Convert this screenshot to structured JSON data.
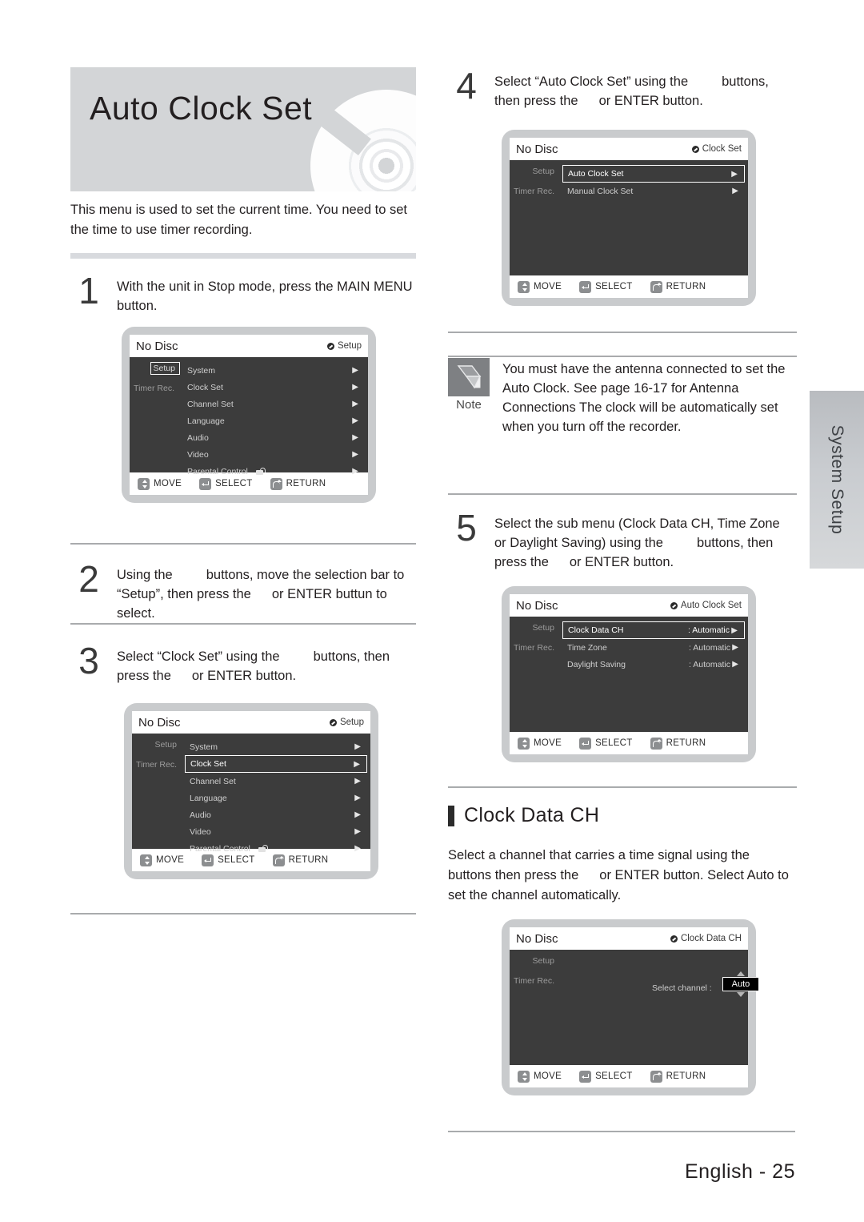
{
  "page": {
    "footer_text": "English - 25",
    "side_tab_label": "System Setup"
  },
  "hero": {
    "title": "Auto Clock Set"
  },
  "intro": {
    "text": "This menu is used to set the current time. You need to set the time to use timer recording."
  },
  "steps": [
    {
      "number": "1",
      "text_before": "With the unit in Stop mode, press the MAIN MENU button.",
      "text_mid": "",
      "text_after": ""
    },
    {
      "number": "2",
      "text_before": "Using the",
      "text_mid": "buttons, move the selection bar to “Setup”, then press the",
      "text_after": "or ENTER buttun to select."
    },
    {
      "number": "3",
      "text_before": "Select “Clock Set” using the",
      "text_mid": "buttons, then press the",
      "text_after": "or ENTER button."
    },
    {
      "number": "4",
      "text_before": "Select “Auto Clock Set” using the",
      "text_mid": "buttons, then press the",
      "text_after": "or ENTER button."
    },
    {
      "number": "5",
      "text_before": "Select the sub menu (Clock Data CH, Time Zone or Daylight Saving) using the",
      "text_mid": "buttons, then press the",
      "text_after": "or ENTER button."
    }
  ],
  "note": {
    "label": "Note",
    "text": "You must have the antenna connected to set the Auto Clock. See page 16-17 for Antenna Connections The clock will be automatically set when you turn off the recorder."
  },
  "section": {
    "title": "Clock Data CH",
    "text_before": "Select a channel that carries a time signal using the",
    "text_mid": "buttons then press the",
    "text_after": "or ENTER button. Select Auto to set the channel automatically."
  },
  "osd_common": {
    "disc_status": "No Disc",
    "sidebar": {
      "setup": "Setup",
      "timer_rec": "Timer Rec."
    },
    "footer": {
      "move": "MOVE",
      "select": "SELECT",
      "return": "RETURN"
    }
  },
  "osd1": {
    "breadcrumb": "Setup",
    "rows": [
      {
        "label": "System"
      },
      {
        "label": "Clock Set"
      },
      {
        "label": "Channel Set"
      },
      {
        "label": "Language"
      },
      {
        "label": "Audio"
      },
      {
        "label": "Video"
      },
      {
        "label": "Parental Control"
      }
    ]
  },
  "osd3": {
    "breadcrumb": "Setup",
    "rows": [
      {
        "label": "System"
      },
      {
        "label": "Clock Set"
      },
      {
        "label": "Channel Set"
      },
      {
        "label": "Language"
      },
      {
        "label": "Audio"
      },
      {
        "label": "Video"
      },
      {
        "label": "Parental Control"
      }
    ]
  },
  "osd4": {
    "breadcrumb": "Clock Set",
    "rows": [
      {
        "label": "Auto Clock Set"
      },
      {
        "label": "Manual Clock Set"
      }
    ]
  },
  "osd5": {
    "breadcrumb": "Auto Clock Set",
    "rows": [
      {
        "label": "Clock Data CH",
        "value": ": Automatic"
      },
      {
        "label": "Time Zone",
        "value": ": Automatic"
      },
      {
        "label": "Daylight Saving",
        "value": ": Automatic"
      }
    ]
  },
  "osd6": {
    "breadcrumb": "Clock Data CH",
    "select_channel_label": "Select channel :",
    "channel_value": "Auto"
  },
  "colors": {
    "osd_panel": "#3c3c3c",
    "osd_frame": "#c9cbcd",
    "hero_bg": "#d3d5d7",
    "rule": "#d8dade",
    "note_icon_bg": "#7e8083"
  }
}
